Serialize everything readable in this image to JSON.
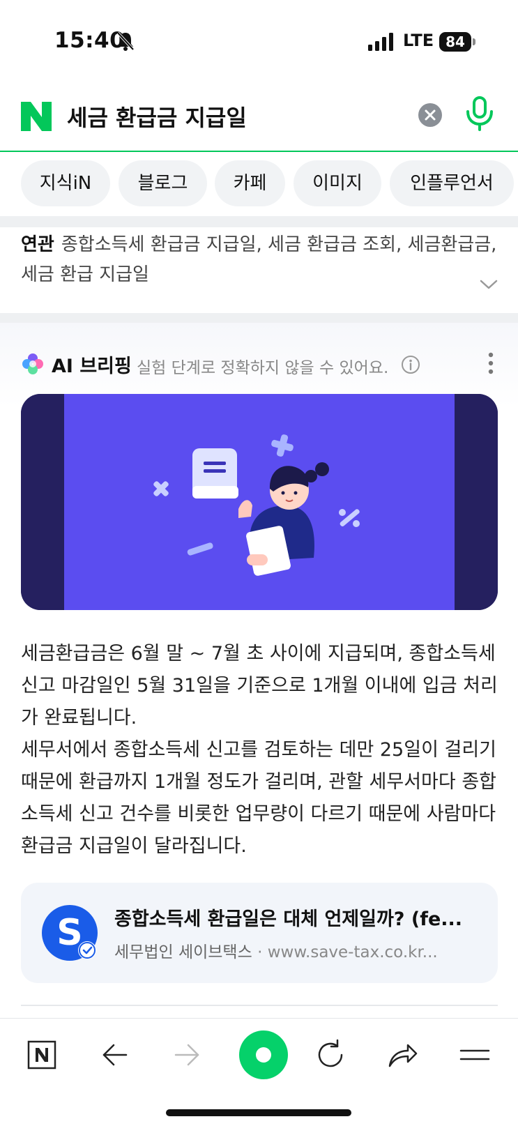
{
  "status_bar": {
    "time": "15:40",
    "network": "LTE",
    "battery": "84",
    "icons": [
      "bell-muted-icon",
      "signal-icon",
      "battery-icon"
    ]
  },
  "search": {
    "logo": "N",
    "query": "세금 환급금 지급일",
    "clear_icon": "close-icon",
    "voice_icon": "microphone-icon",
    "brand_color": "#03c75a"
  },
  "tabs": [
    "지식iN",
    "블로그",
    "카페",
    "이미지",
    "인플루언서"
  ],
  "related": {
    "label": "연관",
    "terms": "종합소득세 환급금 지급일, 세금 환급금 조회, 세금환급금, 세금 환급 지급일",
    "expand_icon": "chevron-down-icon"
  },
  "ai_briefing": {
    "title": "AI 브리핑",
    "disclaimer": "실험 단계로 정확하지 않을 수 있어요.",
    "paragraph1": "세금환급금은 6월 말 ~ 7월 초 사이에 지급되며, 종합소득세 신고 마감일인 5월 31일을 기준으로 1개월 이내에 입금 처리가 완료됩니다.",
    "paragraph2": "세무서에서 종합소득세 신고를 검토하는 데만 25일이 걸리기 때문에 환급까지 1개월 정도가 걸리며, 관할 세무서마다 종합소득세 신고 건수를 비롯한 업무량이 다르기 때문에 사람마다 환급금 지급일이 달라집니다.",
    "source": {
      "avatar_letter": "S",
      "title": "종합소득세 환급일은 대체 언제일까? (fe...",
      "publisher": "세무법인 세이브택스",
      "separator": "·",
      "url": "www.save-tax.co.kr..."
    }
  },
  "toolbar": {
    "items": [
      "naver-home-icon",
      "back-icon",
      "forward-icon",
      "green-dot-icon",
      "refresh-icon",
      "share-icon",
      "menu-icon"
    ]
  }
}
